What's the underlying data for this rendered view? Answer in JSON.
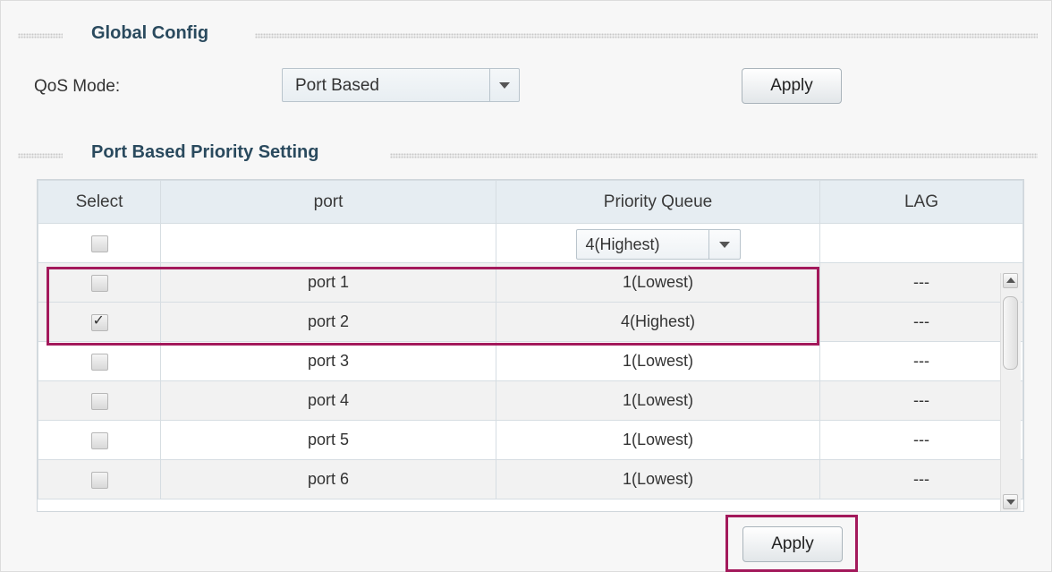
{
  "global_config": {
    "title": "Global Config",
    "qos_mode_label": "QoS Mode:",
    "qos_mode_value": "Port Based",
    "apply_label": "Apply"
  },
  "port_priority": {
    "title": "Port Based Priority Setting",
    "columns": {
      "select": "Select",
      "port": "port",
      "priority": "Priority Queue",
      "lag": "LAG"
    },
    "bulk_priority_value": "4(Highest)",
    "rows": [
      {
        "port": "port 1",
        "priority": "1(Lowest)",
        "lag": "---",
        "checked": false
      },
      {
        "port": "port 2",
        "priority": "4(Highest)",
        "lag": "---",
        "checked": true
      },
      {
        "port": "port 3",
        "priority": "1(Lowest)",
        "lag": "---",
        "checked": false
      },
      {
        "port": "port 4",
        "priority": "1(Lowest)",
        "lag": "---",
        "checked": false
      },
      {
        "port": "port 5",
        "priority": "1(Lowest)",
        "lag": "---",
        "checked": false
      },
      {
        "port": "port 6",
        "priority": "1(Lowest)",
        "lag": "---",
        "checked": false
      }
    ],
    "apply_label": "Apply"
  },
  "colors": {
    "highlight": "#a3195b",
    "section_title": "#2a4a5e",
    "header_bg": "#e6edf2"
  },
  "icons": {
    "checkmark": "✓",
    "dropdown": "chevron-down-icon"
  }
}
